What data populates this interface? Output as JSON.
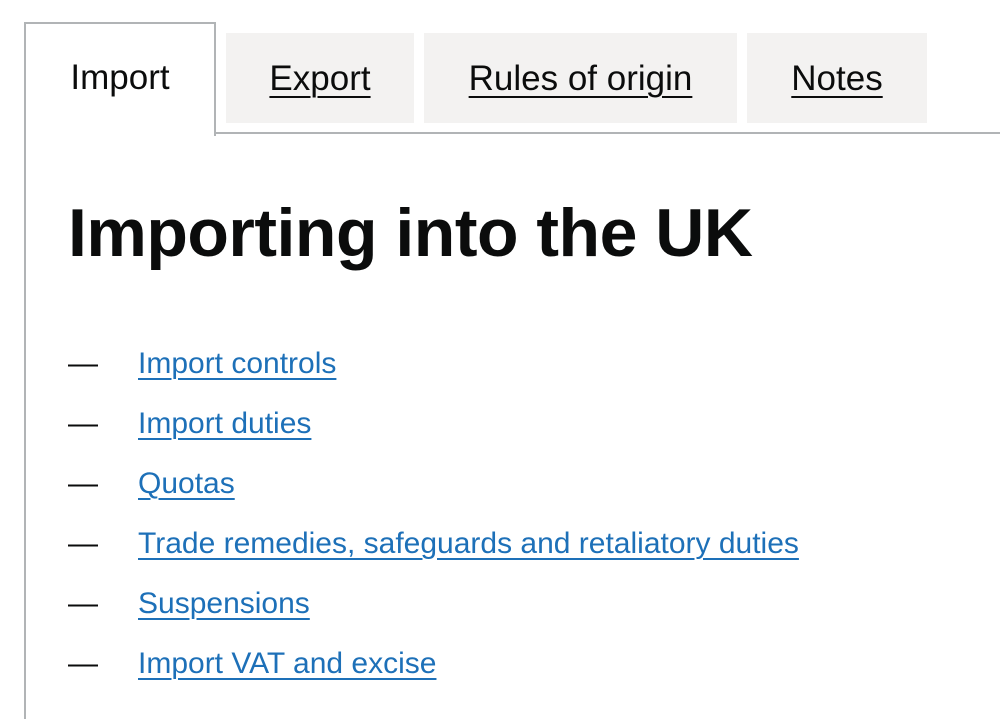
{
  "tabs": [
    {
      "label": "Import",
      "selected": true
    },
    {
      "label": "Export",
      "selected": false
    },
    {
      "label": "Rules of origin",
      "selected": false
    },
    {
      "label": "Notes",
      "selected": false
    }
  ],
  "panel": {
    "title": "Importing into the UK",
    "links": [
      {
        "dash": "—",
        "label": "Import controls"
      },
      {
        "dash": "—",
        "label": "Import duties"
      },
      {
        "dash": "—",
        "label": "Quotas"
      },
      {
        "dash": "—",
        "label": "Trade remedies, safeguards and retaliatory duties"
      },
      {
        "dash": "—",
        "label": "Suspensions"
      },
      {
        "dash": "—",
        "label": "Import VAT and excise"
      }
    ]
  },
  "colors": {
    "link": "#1d70b8",
    "text": "#0b0c0c",
    "border": "#b1b4b6",
    "inactive_tab_bg": "#f3f2f1"
  }
}
